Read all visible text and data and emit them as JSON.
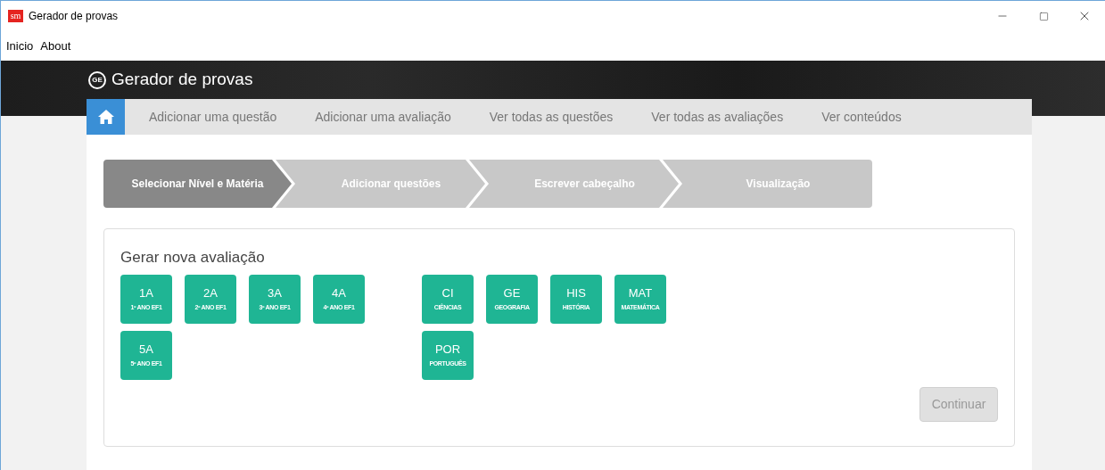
{
  "window": {
    "title": "Gerador de provas",
    "icon_text": "sm"
  },
  "menu": [
    "Inicio",
    "About"
  ],
  "app_title": "Gerador de provas",
  "logo": "GE",
  "nav": {
    "home_selected": true,
    "items": [
      "Adicionar uma questão",
      "Adicionar uma avaliação",
      "Ver todas as questões",
      "Ver todas as avaliações",
      "Ver conteúdos"
    ]
  },
  "steps": [
    {
      "label": "Selecionar Nível e Matéria",
      "selected": true
    },
    {
      "label": "Adicionar questões",
      "selected": false
    },
    {
      "label": "Escrever cabeçalho",
      "selected": false
    },
    {
      "label": "Visualização",
      "selected": false
    }
  ],
  "card": {
    "title": "Gerar nova avaliação",
    "levels": [
      {
        "code": "1A",
        "name": "1º ANO EF1"
      },
      {
        "code": "2A",
        "name": "2º ANO EF1"
      },
      {
        "code": "3A",
        "name": "3º ANO EF1"
      },
      {
        "code": "4A",
        "name": "4º ANO EF1"
      },
      {
        "code": "5A",
        "name": "5º ANO EF1"
      }
    ],
    "subjects": [
      {
        "code": "CI",
        "name": "CIÊNCIAS"
      },
      {
        "code": "GE",
        "name": "GEOGRAFIA"
      },
      {
        "code": "HIS",
        "name": "HISTÓRIA"
      },
      {
        "code": "MAT",
        "name": "MATEMÁTICA"
      },
      {
        "code": "POR",
        "name": "PORTUGUÊS"
      }
    ],
    "continue": {
      "label": "Continuar",
      "disabled": true
    }
  }
}
